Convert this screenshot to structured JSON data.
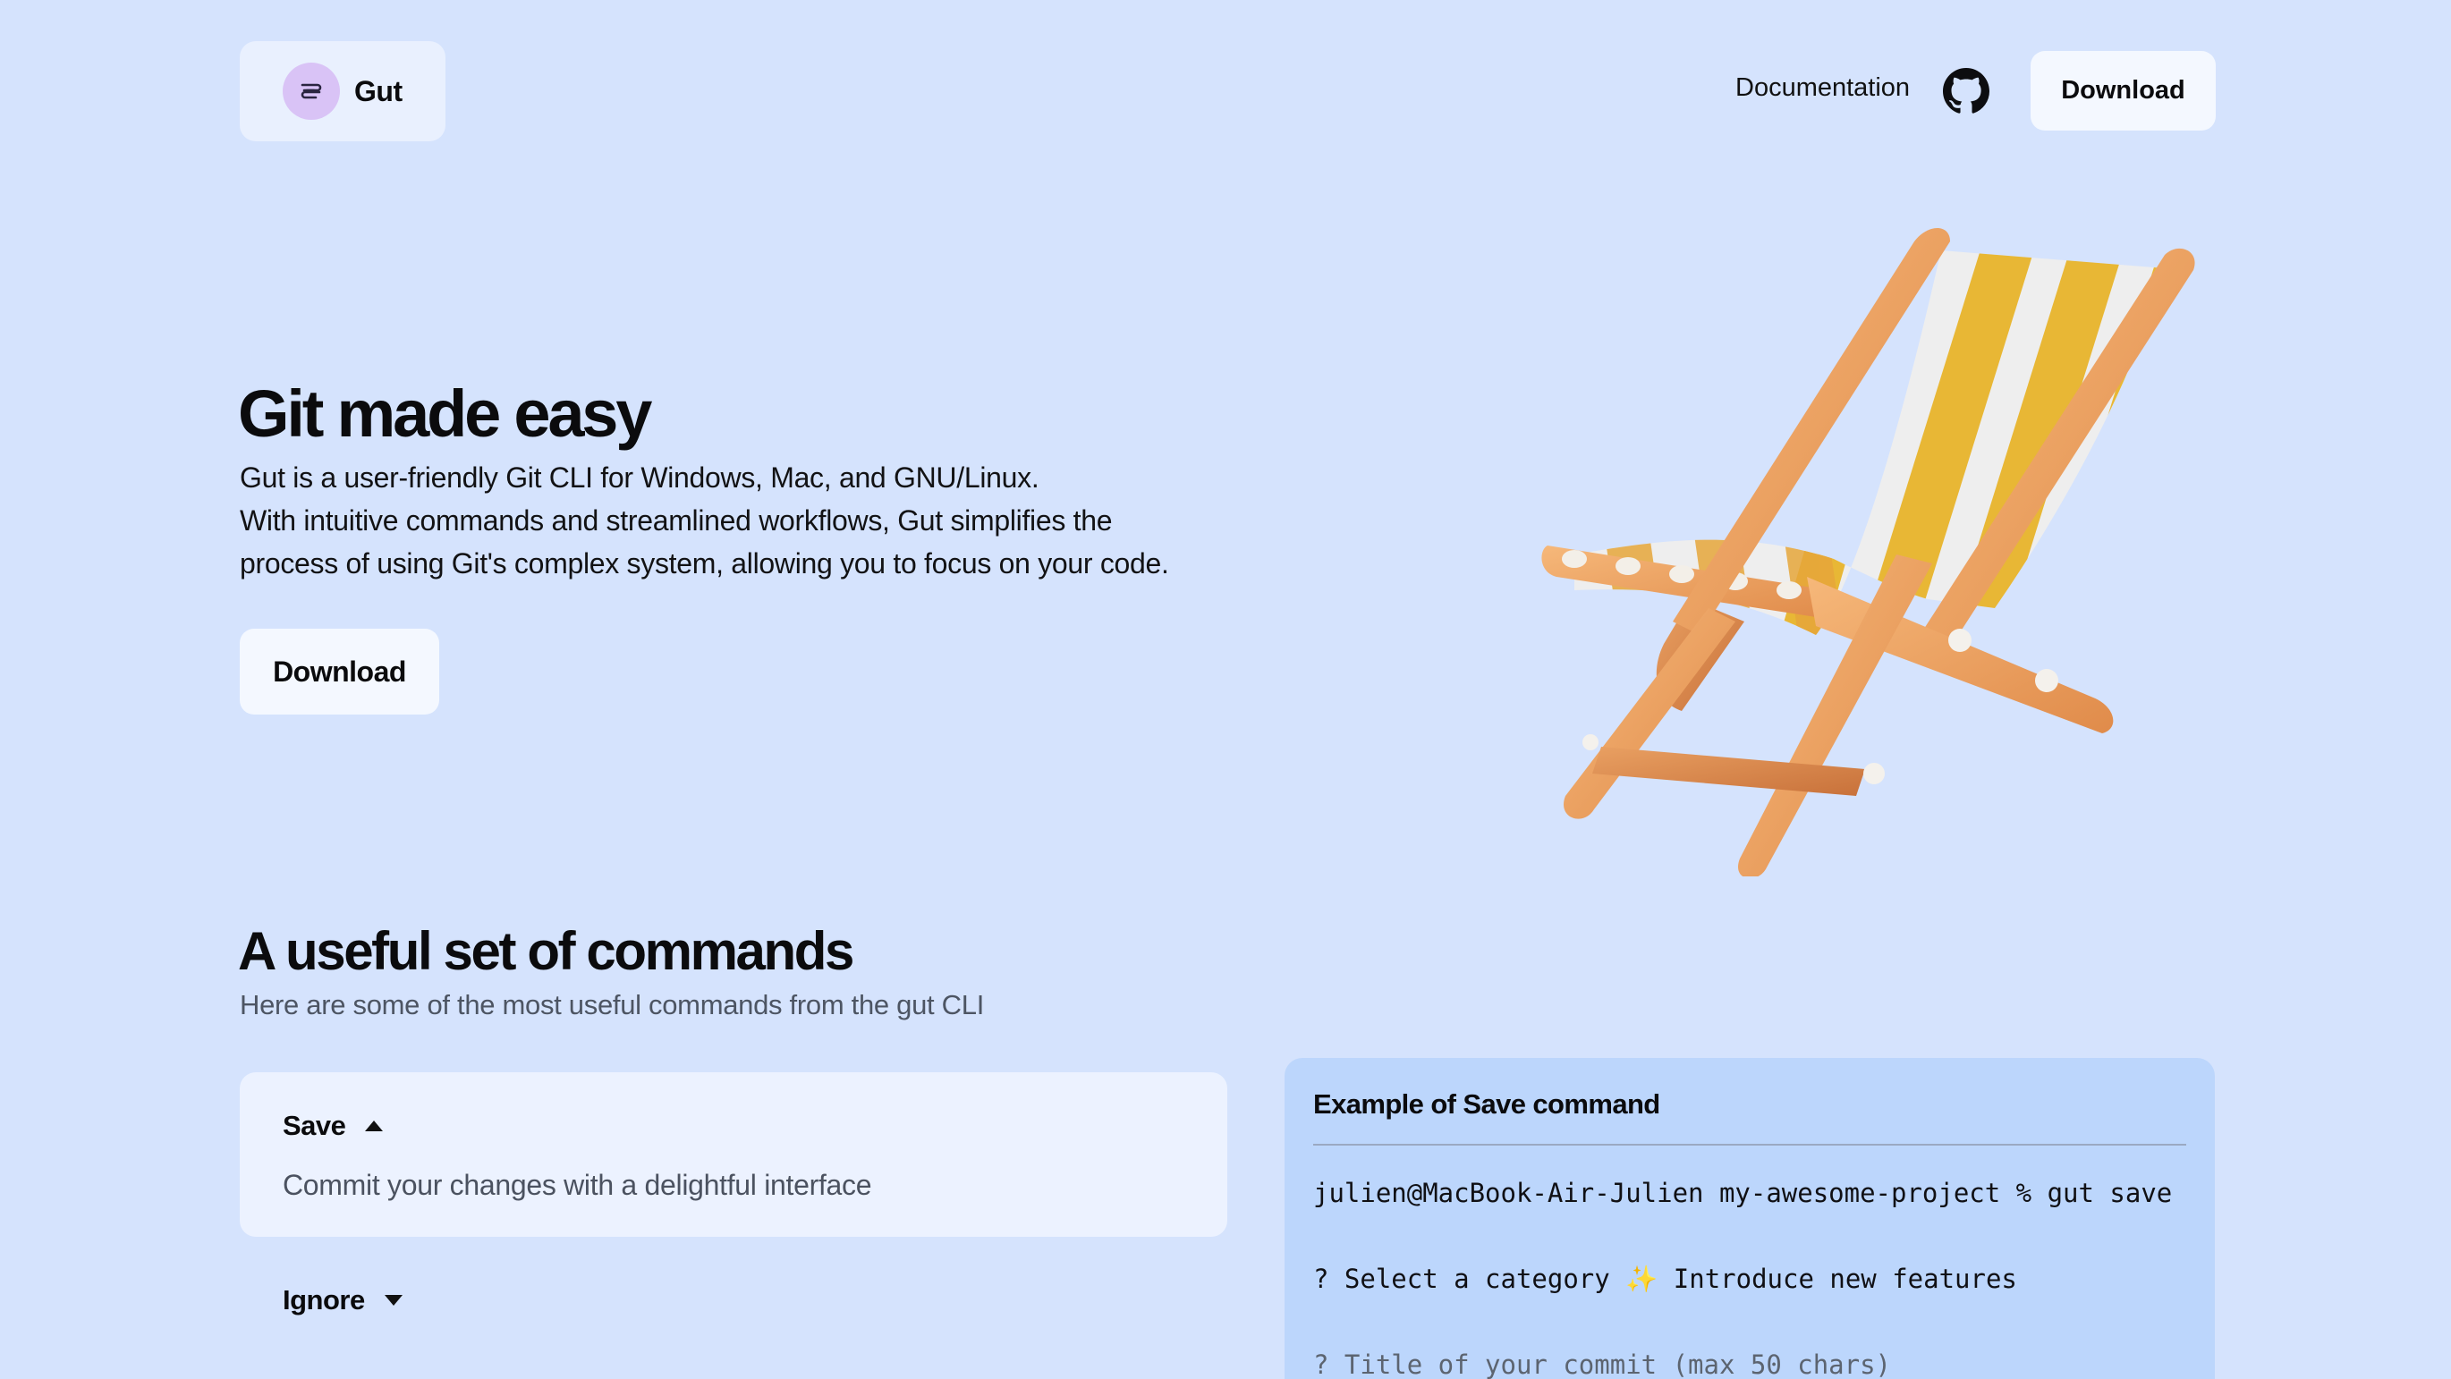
{
  "header": {
    "brand_name": "Gut",
    "nav": {
      "documentation": "Documentation",
      "download": "Download"
    }
  },
  "hero": {
    "title": "Git made easy",
    "line1": "Gut is a user-friendly Git CLI for Windows, Mac, and GNU/Linux.",
    "line2": "With intuitive commands and streamlined workflows, Gut simplifies the",
    "line3": "process of using Git's complex system, allowing you to focus on your code.",
    "download": "Download"
  },
  "commands": {
    "title": "A useful set of commands",
    "subtitle": "Here are some of the most useful commands from the gut CLI",
    "items": [
      {
        "label": "Save",
        "description": "Commit your changes with a delightful interface",
        "expanded": true
      },
      {
        "label": "Ignore",
        "expanded": false
      }
    ]
  },
  "example": {
    "title": "Example of Save command",
    "prompt_line": "julien@MacBook-Air-Julien my-awesome-project % gut save",
    "category_prefix": "? Select a category ",
    "category_emoji": "✨",
    "category_value": " Introduce new features",
    "title_prompt": "? Title of your commit (max 50 chars)"
  },
  "colors": {
    "background": "#d5e3fd",
    "card": "#ecf2ff",
    "button": "#f4f8ff",
    "example_panel": "#bcd6fc",
    "logo_circle": "#d9c3f6"
  },
  "icons": [
    "gut-logo-icon",
    "github-icon",
    "chevron-up-icon",
    "chevron-down-icon",
    "beach-chair-illustration"
  ]
}
